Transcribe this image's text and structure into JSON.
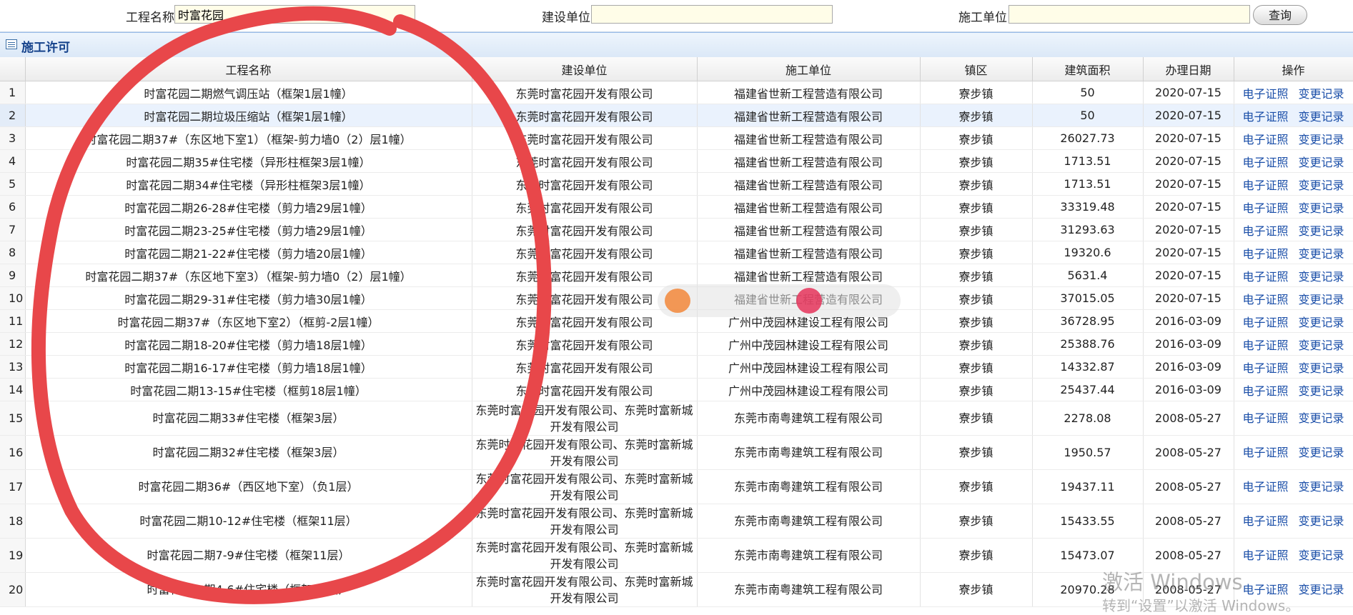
{
  "search": {
    "project_label": "工程名称:",
    "project_value": "时富花园",
    "builder_label": "建设单位:",
    "builder_value": "",
    "contractor_label": "施工单位:",
    "contractor_value": "",
    "query_label": "查询"
  },
  "panel": {
    "title": "施工许可"
  },
  "table": {
    "headers": [
      "工程名称",
      "建设单位",
      "施工单位",
      "镇区",
      "建筑面积",
      "办理日期",
      "操作"
    ],
    "rows": [
      {
        "no": "1",
        "name": "时富花园二期燃气调压站（框架1层1幢）",
        "builder": "东莞时富花园开发有限公司",
        "contractor": "福建省世新工程营造有限公司",
        "town": "寮步镇",
        "area": "50",
        "date": "2020-07-15",
        "op1": "电子证照",
        "op2": "变更记录"
      },
      {
        "no": "2",
        "name": "时富花园二期垃圾压缩站（框架1层1幢）",
        "builder": "东莞时富花园开发有限公司",
        "contractor": "福建省世新工程营造有限公司",
        "town": "寮步镇",
        "area": "50",
        "date": "2020-07-15",
        "op1": "电子证照",
        "op2": "变更记录"
      },
      {
        "no": "3",
        "name": "时富花园二期37#（东区地下室1）（框架-剪力墙0（2）层1幢）",
        "builder": "东莞时富花园开发有限公司",
        "contractor": "福建省世新工程营造有限公司",
        "town": "寮步镇",
        "area": "26027.73",
        "date": "2020-07-15",
        "op1": "电子证照",
        "op2": "变更记录"
      },
      {
        "no": "4",
        "name": "时富花园二期35#住宅楼（异形柱框架3层1幢）",
        "builder": "东莞时富花园开发有限公司",
        "contractor": "福建省世新工程营造有限公司",
        "town": "寮步镇",
        "area": "1713.51",
        "date": "2020-07-15",
        "op1": "电子证照",
        "op2": "变更记录"
      },
      {
        "no": "5",
        "name": "时富花园二期34#住宅楼（异形柱框架3层1幢）",
        "builder": "东莞时富花园开发有限公司",
        "contractor": "福建省世新工程营造有限公司",
        "town": "寮步镇",
        "area": "1713.51",
        "date": "2020-07-15",
        "op1": "电子证照",
        "op2": "变更记录"
      },
      {
        "no": "6",
        "name": "时富花园二期26-28#住宅楼（剪力墙29层1幢）",
        "builder": "东莞时富花园开发有限公司",
        "contractor": "福建省世新工程营造有限公司",
        "town": "寮步镇",
        "area": "33319.48",
        "date": "2020-07-15",
        "op1": "电子证照",
        "op2": "变更记录"
      },
      {
        "no": "7",
        "name": "时富花园二期23-25#住宅楼（剪力墙29层1幢）",
        "builder": "东莞时富花园开发有限公司",
        "contractor": "福建省世新工程营造有限公司",
        "town": "寮步镇",
        "area": "31293.63",
        "date": "2020-07-15",
        "op1": "电子证照",
        "op2": "变更记录"
      },
      {
        "no": "8",
        "name": "时富花园二期21-22#住宅楼（剪力墙20层1幢）",
        "builder": "东莞时富花园开发有限公司",
        "contractor": "福建省世新工程营造有限公司",
        "town": "寮步镇",
        "area": "19320.6",
        "date": "2020-07-15",
        "op1": "电子证照",
        "op2": "变更记录"
      },
      {
        "no": "9",
        "name": "时富花园二期37#（东区地下室3）（框架-剪力墙0（2）层1幢）",
        "builder": "东莞时富花园开发有限公司",
        "contractor": "福建省世新工程营造有限公司",
        "town": "寮步镇",
        "area": "5631.4",
        "date": "2020-07-15",
        "op1": "电子证照",
        "op2": "变更记录"
      },
      {
        "no": "10",
        "name": "时富花园二期29-31#住宅楼（剪力墙30层1幢）",
        "builder": "东莞时富花园开发有限公司",
        "contractor": "福建省世新工程营造有限公司",
        "town": "寮步镇",
        "area": "37015.05",
        "date": "2020-07-15",
        "op1": "电子证照",
        "op2": "变更记录"
      },
      {
        "no": "11",
        "name": "时富花园二期37#（东区地下室2）（框剪-2层1幢）",
        "builder": "东莞时富花园开发有限公司",
        "contractor": "广州中茂园林建设工程有限公司",
        "town": "寮步镇",
        "area": "36728.95",
        "date": "2016-03-09",
        "op1": "电子证照",
        "op2": "变更记录"
      },
      {
        "no": "12",
        "name": "时富花园二期18-20#住宅楼（剪力墙18层1幢）",
        "builder": "东莞时富花园开发有限公司",
        "contractor": "广州中茂园林建设工程有限公司",
        "town": "寮步镇",
        "area": "25388.76",
        "date": "2016-03-09",
        "op1": "电子证照",
        "op2": "变更记录"
      },
      {
        "no": "13",
        "name": "时富花园二期16-17#住宅楼（剪力墙18层1幢）",
        "builder": "东莞时富花园开发有限公司",
        "contractor": "广州中茂园林建设工程有限公司",
        "town": "寮步镇",
        "area": "14332.87",
        "date": "2016-03-09",
        "op1": "电子证照",
        "op2": "变更记录"
      },
      {
        "no": "14",
        "name": "时富花园二期13-15#住宅楼（框剪18层1幢）",
        "builder": "东莞时富花园开发有限公司",
        "contractor": "广州中茂园林建设工程有限公司",
        "town": "寮步镇",
        "area": "25437.44",
        "date": "2016-03-09",
        "op1": "电子证照",
        "op2": "变更记录"
      },
      {
        "no": "15",
        "name": "时富花园二期33#住宅楼（框架3层）",
        "builder": "东莞时富花园开发有限公司、东莞时富新城开发有限公司",
        "contractor": "东莞市南粤建筑工程有限公司",
        "town": "寮步镇",
        "area": "2278.08",
        "date": "2008-05-27",
        "op1": "电子证照",
        "op2": "变更记录"
      },
      {
        "no": "16",
        "name": "时富花园二期32#住宅楼（框架3层）",
        "builder": "东莞时富花园开发有限公司、东莞时富新城开发有限公司",
        "contractor": "东莞市南粤建筑工程有限公司",
        "town": "寮步镇",
        "area": "1950.57",
        "date": "2008-05-27",
        "op1": "电子证照",
        "op2": "变更记录"
      },
      {
        "no": "17",
        "name": "时富花园二期36#（西区地下室）（负1层）",
        "builder": "东莞时富花园开发有限公司、东莞时富新城开发有限公司",
        "contractor": "东莞市南粤建筑工程有限公司",
        "town": "寮步镇",
        "area": "19437.11",
        "date": "2008-05-27",
        "op1": "电子证照",
        "op2": "变更记录"
      },
      {
        "no": "18",
        "name": "时富花园二期10-12#住宅楼（框架11层）",
        "builder": "东莞时富花园开发有限公司、东莞时富新城开发有限公司",
        "contractor": "东莞市南粤建筑工程有限公司",
        "town": "寮步镇",
        "area": "15433.55",
        "date": "2008-05-27",
        "op1": "电子证照",
        "op2": "变更记录"
      },
      {
        "no": "19",
        "name": "时富花园二期7-9#住宅楼（框架11层）",
        "builder": "东莞时富花园开发有限公司、东莞时富新城开发有限公司",
        "contractor": "东莞市南粤建筑工程有限公司",
        "town": "寮步镇",
        "area": "15473.07",
        "date": "2008-05-27",
        "op1": "电子证照",
        "op2": "变更记录"
      },
      {
        "no": "20",
        "name": "时富花园二期4-6#住宅楼（框架18层）",
        "builder": "东莞时富花园开发有限公司、东莞时富新城开发有限公司",
        "contractor": "东莞市南粤建筑工程有限公司",
        "town": "寮步镇",
        "area": "20970.28",
        "date": "2008-05-27",
        "op1": "电子证照",
        "op2": "变更记录"
      }
    ]
  },
  "overlay": {
    "activation_title": "激活 Windows",
    "activation_sub": "转到“设置”以激活 Windows。",
    "stroke_color": "#e8474a"
  }
}
